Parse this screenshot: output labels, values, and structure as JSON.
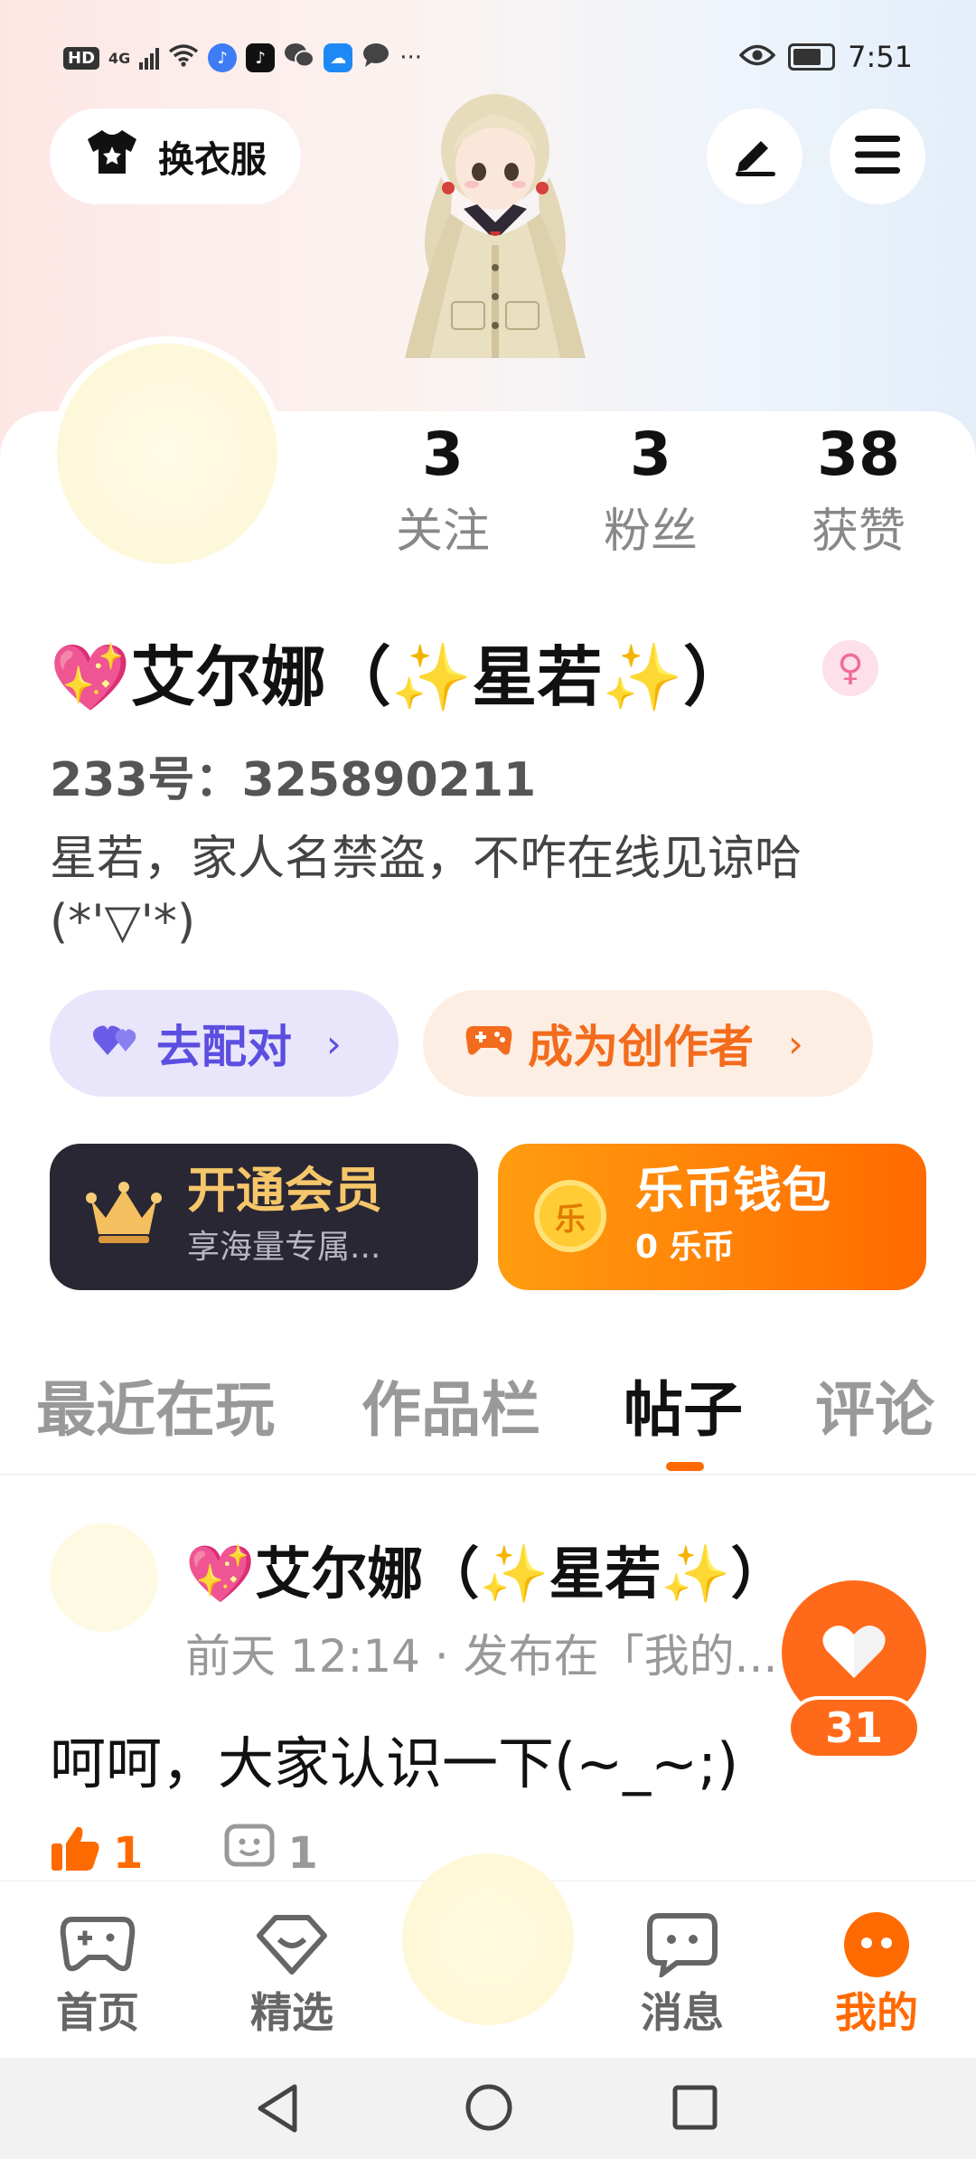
{
  "status_bar": {
    "left_indicators": [
      "HD",
      "4G"
    ],
    "more": "···",
    "time": "7:51"
  },
  "header": {
    "outfit_label": "换衣服"
  },
  "stats": [
    {
      "num": "3",
      "label": "关注"
    },
    {
      "num": "3",
      "label": "粉丝"
    },
    {
      "num": "38",
      "label": "获赞"
    }
  ],
  "profile": {
    "name": "💖艾尔娜（✨星若✨）",
    "uid": "233号：325890211",
    "bio": "星若，家人名禁盗，不咋在线见谅哈(*'▽'*)"
  },
  "pills": {
    "match": "去配对",
    "creator": "成为创作者",
    "chevron": "›"
  },
  "cards": {
    "vip_title": "开通会员",
    "vip_sub": "享海量专属...",
    "wallet_title": "乐币钱包",
    "wallet_sub": "0 乐币",
    "coin_char": "乐"
  },
  "tabs": [
    "最近在玩",
    "作品栏",
    "帖子",
    "评论"
  ],
  "post": {
    "author": "💖艾尔娜（✨星若✨）",
    "meta": "前天 12:14 · 发布在「我的...",
    "text": "呵呵，大家认识一下(~_~;)",
    "likes": "1",
    "comments": "1"
  },
  "floating_like_count": "31",
  "bottom_nav": [
    "首页",
    "精选",
    "消息",
    "我的"
  ],
  "colors": {
    "accent": "#ff6a00",
    "vip_bg": "#2a2734",
    "vip_text": "#f5c66a",
    "match_bg": "#e9e6fb",
    "match_text": "#5b4ee0",
    "creator_bg": "#fdeee3",
    "creator_text": "#f36b1c"
  }
}
